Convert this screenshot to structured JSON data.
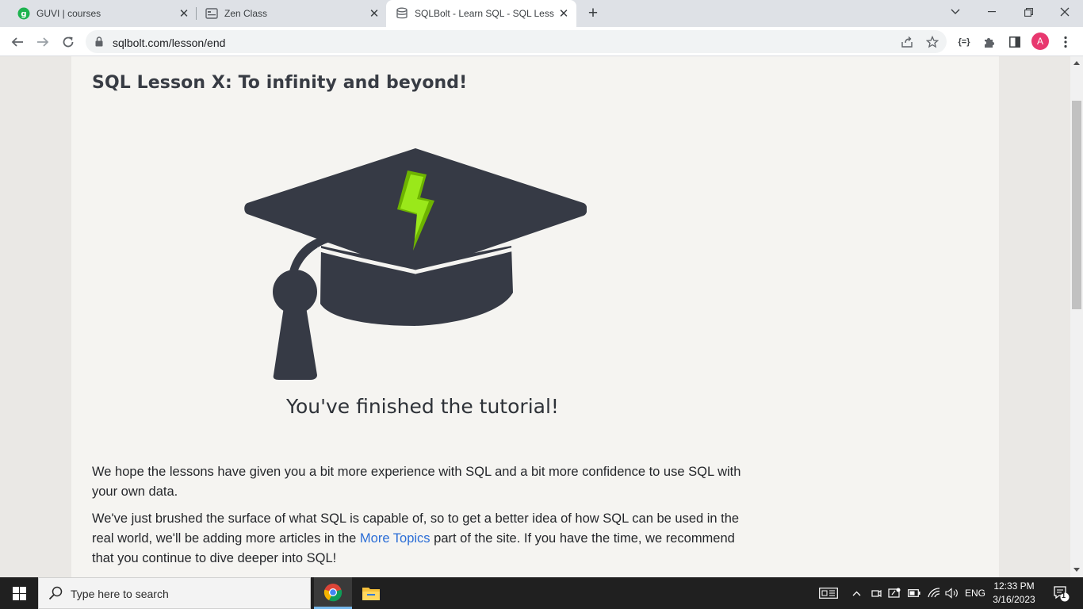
{
  "browser": {
    "tabs": [
      {
        "title": "GUVI | courses",
        "icon": "guvi-logo-icon"
      },
      {
        "title": "Zen Class",
        "icon": "zen-class-icon"
      },
      {
        "title": "SQLBolt - Learn SQL - SQL Lesson",
        "icon": "database-icon"
      }
    ],
    "new_tab": "+",
    "url": "sqlbolt.com/lesson/end",
    "profile_initial": "A"
  },
  "page": {
    "lesson_title": "SQL Lesson X: To infinity and beyond!",
    "finished_caption": "You've finished the tutorial!",
    "paragraph1": "We hope the lessons have given you a bit more experience with SQL and a bit more confidence to use SQL with your own data.",
    "paragraph2_before": "We've just brushed the surface of what SQL is capable of, so to get a better idea of how SQL can be used in the real world, we'll be adding more articles in the ",
    "paragraph2_link": "More Topics",
    "paragraph2_after": " part of the site. If you have the time, we recommend that you continue to dive deeper into SQL!"
  },
  "taskbar": {
    "search_placeholder": "Type here to search",
    "language": "ENG",
    "time": "12:33 PM",
    "date": "3/16/2023",
    "notification_count": "1"
  },
  "colors": {
    "cap": "#363a45",
    "bolt": "#8ee000",
    "link": "#2a6dd6"
  }
}
